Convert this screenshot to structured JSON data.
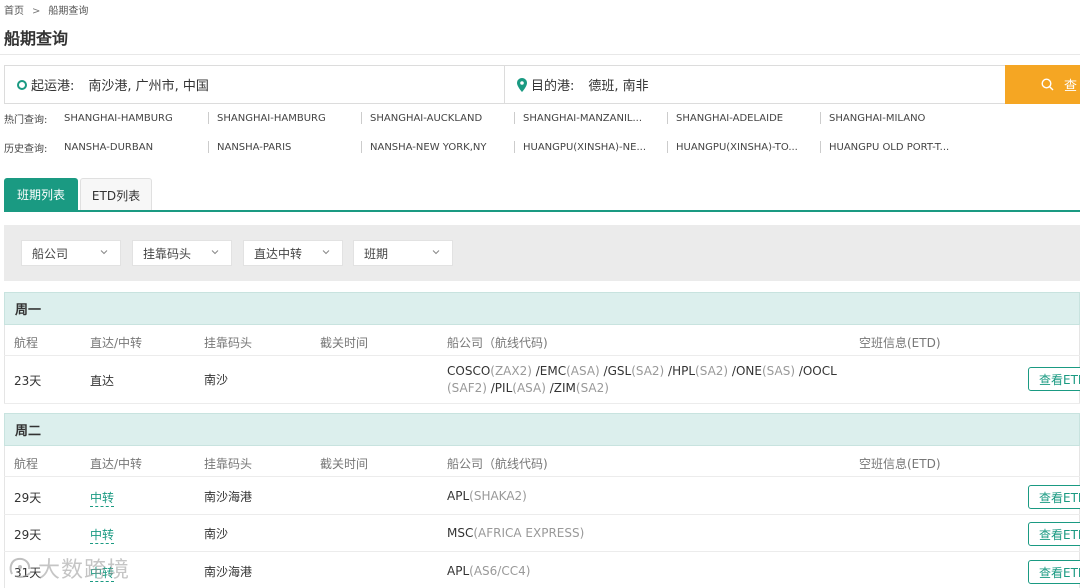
{
  "breadcrumb": {
    "home": "首页",
    "separator": ">",
    "current": "船期查询"
  },
  "page_title": "船期查询",
  "search": {
    "origin_label": "起运港:",
    "origin_value": "南沙港, 广州市, 中国",
    "dest_label": "目的港:",
    "dest_value": "德班, 南非",
    "button_label": "查"
  },
  "hot_queries": {
    "label": "热门查询:",
    "items": [
      "SHANGHAI-HAMBURG",
      "SHANGHAI-HAMBURG",
      "SHANGHAI-AUCKLAND",
      "SHANGHAI-MANZANIL...",
      "SHANGHAI-ADELAIDE",
      "SHANGHAI-MILANO"
    ]
  },
  "history_queries": {
    "label": "历史查询:",
    "items": [
      "NANSHA-DURBAN",
      "NANSHA-PARIS",
      "NANSHA-NEW YORK,NY",
      "HUANGPU(XINSHA)-NE...",
      "HUANGPU(XINSHA)-TO...",
      "HUANGPU OLD PORT-T..."
    ]
  },
  "tabs": [
    {
      "label": "班期列表",
      "active": true
    },
    {
      "label": "ETD列表",
      "active": false
    }
  ],
  "filters": [
    "船公司",
    "挂靠码头",
    "直达中转",
    "班期"
  ],
  "columns": [
    "航程",
    "直达/中转",
    "挂靠码头",
    "截关时间",
    "船公司（航线代码)",
    "空班信息(ETD)"
  ],
  "groups": [
    {
      "day": "周一",
      "rows": [
        {
          "duration": "23天",
          "route_type": "直达",
          "is_transfer": false,
          "terminal": "南沙",
          "carriers_line1": [
            {
              "name": "COSCO",
              "code": "(ZAX2)"
            },
            {
              "name": " /EMC",
              "code": "(ASA)"
            },
            {
              "name": " /GSL",
              "code": "(SA2)"
            },
            {
              "name": " /HPL",
              "code": "(SA2)"
            },
            {
              "name": " /ONE",
              "code": "(SAS)"
            },
            {
              "name": " /OOCL",
              "code": ""
            }
          ],
          "carriers_line2": [
            {
              "name": "",
              "code": "(SAF2)"
            },
            {
              "name": " /PIL",
              "code": "(ASA)"
            },
            {
              "name": " /ZIM",
              "code": "(SA2)"
            }
          ],
          "etd_button": "查看ETD"
        }
      ]
    },
    {
      "day": "周二",
      "rows": [
        {
          "duration": "29天",
          "route_type": "中转",
          "is_transfer": true,
          "terminal": "南沙海港",
          "carriers_line1": [
            {
              "name": "APL",
              "code": "(SHAKA2)"
            }
          ],
          "carriers_line2": [],
          "etd_button": "查看ETD"
        },
        {
          "duration": "29天",
          "route_type": "中转",
          "is_transfer": true,
          "terminal": "南沙",
          "carriers_line1": [
            {
              "name": "MSC",
              "code": "(AFRICA EXPRESS)"
            }
          ],
          "carriers_line2": [],
          "etd_button": "查看ETD"
        },
        {
          "duration": "31天",
          "route_type": "中转",
          "is_transfer": true,
          "terminal": "南沙海港",
          "carriers_line1": [
            {
              "name": "APL",
              "code": "(AS6/CC4)"
            }
          ],
          "carriers_line2": [],
          "etd_button": "查看ETD"
        }
      ]
    }
  ],
  "watermark": "大数跨境",
  "colors": {
    "accent": "#1a9a82",
    "search_button": "#f5a623",
    "day_band": "#dcefed",
    "filter_panel": "#ebebeb"
  }
}
